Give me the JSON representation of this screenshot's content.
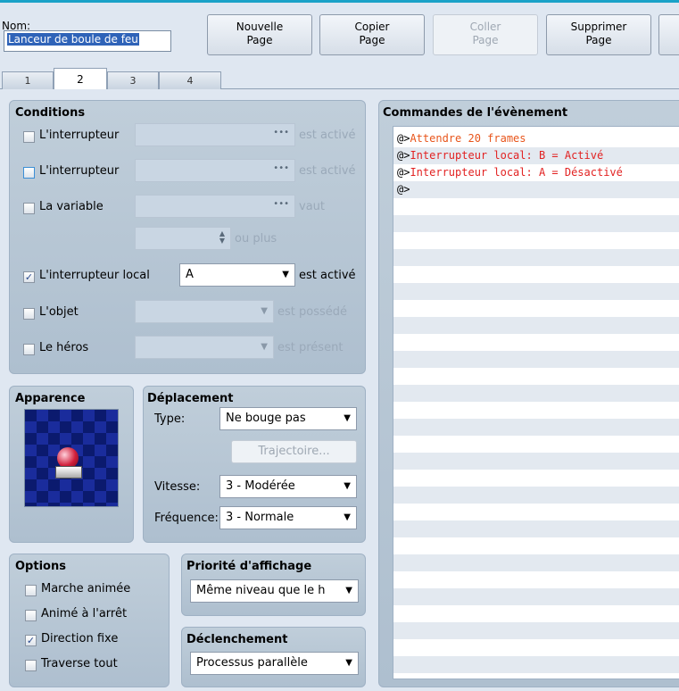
{
  "header": {
    "name_label": "Nom:",
    "name_value": "Lanceur de boule de feu",
    "buttons": [
      {
        "label": "Nouvelle\nPage",
        "enabled": true
      },
      {
        "label": "Copier\nPage",
        "enabled": true
      },
      {
        "label": "Coller\nPage",
        "enabled": false
      },
      {
        "label": "Supprimer\nPage",
        "enabled": true
      }
    ]
  },
  "tabs": [
    {
      "label": "1",
      "active": false
    },
    {
      "label": "2",
      "active": true
    },
    {
      "label": "3",
      "active": false
    },
    {
      "label": "4",
      "active": false
    }
  ],
  "conditions": {
    "title": "Conditions",
    "switch1": {
      "label": "L'interrupteur",
      "checked": false,
      "suffix": "est activé"
    },
    "switch2": {
      "label": "L'interrupteur",
      "checked": false,
      "suffix": "est activé"
    },
    "variable": {
      "label": "La variable",
      "checked": false,
      "suffix": "vaut",
      "or_more": "ou plus"
    },
    "self_switch": {
      "label": "L'interrupteur local",
      "checked": true,
      "value": "A",
      "suffix": "est activé"
    },
    "item": {
      "label": "L'objet",
      "checked": false,
      "suffix": "est possédé"
    },
    "actor": {
      "label": "Le héros",
      "checked": false,
      "suffix": "est présent"
    }
  },
  "appearance": {
    "title": "Apparence"
  },
  "movement": {
    "title": "Déplacement",
    "type_label": "Type:",
    "type_value": "Ne bouge pas",
    "route_button": "Trajectoire...",
    "speed_label": "Vitesse:",
    "speed_value": "3 - Modérée",
    "freq_label": "Fréquence:",
    "freq_value": "3 - Normale"
  },
  "options": {
    "title": "Options",
    "items": [
      {
        "label": "Marche animée",
        "checked": false
      },
      {
        "label": "Animé à l'arrêt",
        "checked": false
      },
      {
        "label": "Direction fixe",
        "checked": true
      },
      {
        "label": "Traverse tout",
        "checked": false
      }
    ]
  },
  "priority": {
    "title": "Priorité d'affichage",
    "value": "Même niveau que le h"
  },
  "trigger": {
    "title": "Déclenchement",
    "value": "Processus parallèle"
  },
  "commands": {
    "title": "Commandes de l'évènement",
    "lines": [
      {
        "prefix": "@>",
        "text": "Attendre 20 frames",
        "color": "#e8551b"
      },
      {
        "prefix": "@>",
        "text": "Interrupteur local: B = Activé",
        "color": "#e22222"
      },
      {
        "prefix": "@>",
        "text": "Interrupteur local: A = Désactivé",
        "color": "#e22222"
      },
      {
        "prefix": "@>",
        "text": "",
        "color": "#000000"
      }
    ]
  },
  "colors": {
    "accent": "#1aa2c8",
    "selection": "#2f63b8",
    "command_red": "#e22222",
    "command_orange": "#e8551b"
  },
  "icons": {
    "checkmark": "check-icon",
    "dropdown": "chevron-down-icon",
    "ellipsis": "ellipsis-icon",
    "spinner": "spinner-icon"
  }
}
